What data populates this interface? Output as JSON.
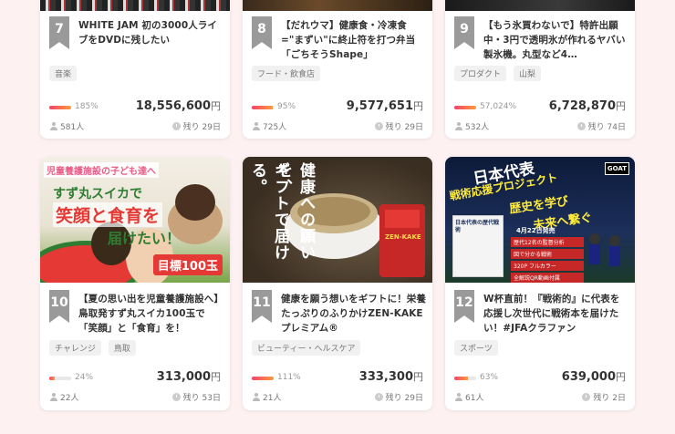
{
  "cards": [
    {
      "rank": "7",
      "title": "WHITE JAM 初の3000人ライブをDVDに残したい",
      "tags": [
        "音楽"
      ],
      "pct_label": "185%",
      "pct_value": 185,
      "amount": "18,556,600",
      "yen": "円",
      "backers": "581人",
      "remain": "残り 29日"
    },
    {
      "rank": "8",
      "title": "【だれウマ】健康食・冷凍食=\"まずい\"に終止符を打つ弁当「ごちそうShape」",
      "tags": [
        "フード・飲食店"
      ],
      "pct_label": "95%",
      "pct_value": 95,
      "amount": "9,577,651",
      "yen": "円",
      "backers": "725人",
      "remain": "残り 29日"
    },
    {
      "rank": "9",
      "title": "【もう氷買わないで】特許出願中・3円で透明氷が作れるヤバい製氷機。丸型など4…",
      "tags": [
        "プロダクト",
        "山梨"
      ],
      "pct_label": "57,024%",
      "pct_value": 100,
      "amount": "6,728,870",
      "yen": "円",
      "backers": "532人",
      "remain": "残り 74日"
    },
    {
      "rank": "10",
      "title": "【夏の思い出を児童養護施設へ】鳥取発すず丸スイカ100玉で「笑顔」と「食育」を！",
      "tags": [
        "チャレンジ",
        "鳥取"
      ],
      "pct_label": "24%",
      "pct_value": 24,
      "amount": "313,000",
      "yen": "円",
      "backers": "22人",
      "remain": "残り 53日",
      "thumb": {
        "line1": "児童養護施設の子ども達へ",
        "line2": "すず丸スイカで",
        "line3": "笑顔と食育を",
        "line4": "届けたい！",
        "badge": "目標100玉"
      }
    },
    {
      "rank": "11",
      "title": "健康を願う想いをギフトに！栄養たっぷりのふりかけZEN-KAKEプレミアム®",
      "tags": [
        "ビューティー・ヘルスケア"
      ],
      "pct_label": "111%",
      "pct_value": 100,
      "amount": "333,300",
      "yen": "円",
      "backers": "21人",
      "remain": "残り 29日",
      "thumb": {
        "vtext1": "健康への願いを、",
        "vtext2": "ギフトで届ける。",
        "pack": "ZEN-KAKE"
      }
    },
    {
      "rank": "12",
      "title": "W杯直前！『戦術的』に代表を応援し次世代に戦術本を届けたい！#JFAクラファン",
      "tags": [
        "スポーツ"
      ],
      "pct_label": "63%",
      "pct_value": 63,
      "amount": "639,000",
      "yen": "円",
      "backers": "61人",
      "remain": "残り 2日",
      "thumb": {
        "head1": "日本代表",
        "head2": "戦術応援プロジェクト",
        "head3": "歴史を学び",
        "head4": "未来へ繋ぐ",
        "date": "4月22日発売",
        "book": "日本代表の歴代戦術",
        "bullets": [
          "歴代12名の監督分析",
          "図で分かる戦術",
          "320P フルカラー",
          "全解説QR動画付属"
        ],
        "logo": "GOAT"
      }
    }
  ]
}
